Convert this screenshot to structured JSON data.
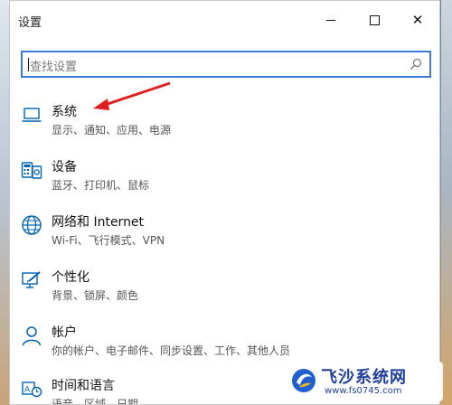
{
  "window": {
    "title": "设置"
  },
  "search": {
    "placeholder": "查找设置"
  },
  "items": [
    {
      "icon": "laptop-icon",
      "title": "系统",
      "desc": "显示、通知、应用、电源"
    },
    {
      "icon": "keyboard-printer-icon",
      "title": "设备",
      "desc": "蓝牙、打印机、鼠标"
    },
    {
      "icon": "globe-icon",
      "title": "网络和 Internet",
      "desc": "Wi-Fi、飞行模式、VPN"
    },
    {
      "icon": "personalization-icon",
      "title": "个性化",
      "desc": "背景、锁屏、颜色"
    },
    {
      "icon": "person-icon",
      "title": "帐户",
      "desc": "你的帐户、电子邮件、同步设置、工作、其他人员"
    },
    {
      "icon": "time-language-icon",
      "title": "时间和语言",
      "desc": "语音、区域、日期"
    }
  ],
  "watermark": {
    "title": "飞沙系统网",
    "url": "www.fs0745.com"
  },
  "colors": {
    "accent": "#0063b1",
    "search_border": "#3a7bd5",
    "arrow": "#e02020"
  }
}
